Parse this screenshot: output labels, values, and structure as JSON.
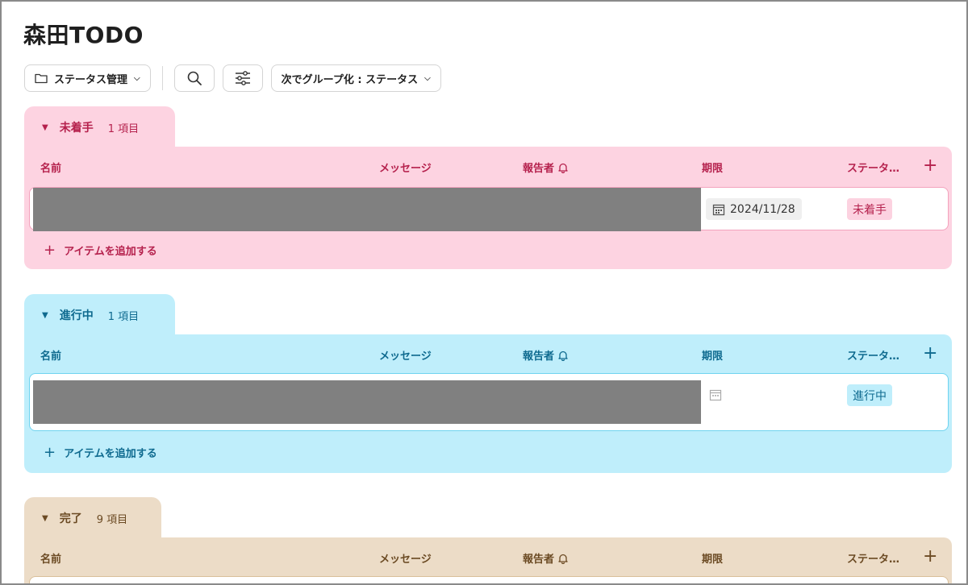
{
  "page": {
    "title": "森田TODO"
  },
  "toolbar": {
    "view_label": "ステータス管理",
    "group_by_label": "次でグループ化 : ステータス",
    "search_icon": "search-icon",
    "filter_icon": "filter-sliders-icon"
  },
  "columns": {
    "name": "名前",
    "message": "メッセージ",
    "reporter": "報告者",
    "deadline": "期限",
    "status": "ステータ…",
    "add": "+"
  },
  "groups": [
    {
      "label": "未着手",
      "count": "1 項目",
      "row_date": "2024/11/28",
      "row_status": "未着手",
      "add_item": "アイテムを追加する",
      "color": "#fdd3e1",
      "accent": "#b5214d"
    },
    {
      "label": "進行中",
      "count": "1 項目",
      "row_date": "",
      "row_status": "進行中",
      "add_item": "アイテムを追加する",
      "color": "#bfeefb",
      "accent": "#0e6a8f"
    },
    {
      "label": "完了",
      "count": "9 項目",
      "color": "#ecdcc7",
      "accent": "#6b4a23"
    }
  ]
}
